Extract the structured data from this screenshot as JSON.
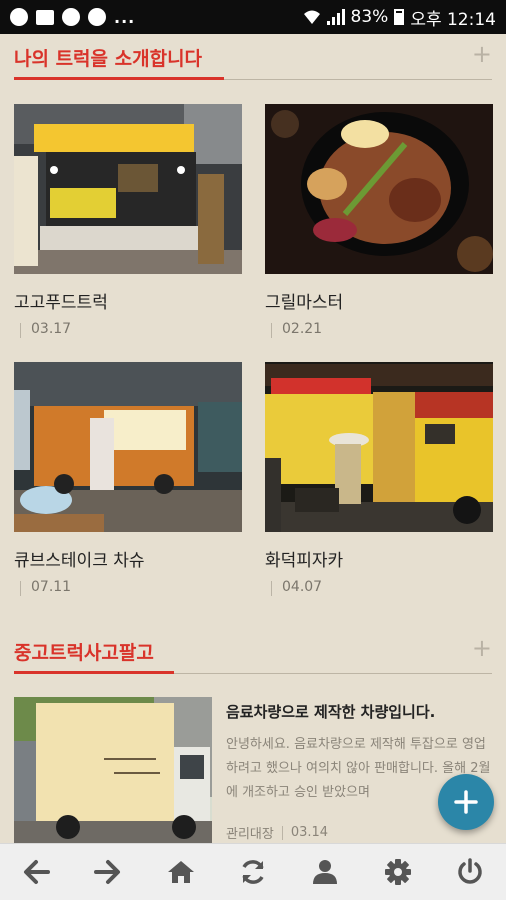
{
  "status_bar": {
    "battery": "83%",
    "time": "오후 12:14",
    "more": "..."
  },
  "sections": {
    "trucks": {
      "title": "나의 트럭을 소개합니다",
      "items": [
        {
          "title": "고고푸드트럭",
          "date": "03.17"
        },
        {
          "title": "그릴마스터",
          "date": "02.21"
        },
        {
          "title": "큐브스테이크 차슈",
          "date": "07.11"
        },
        {
          "title": "화덕피자카",
          "date": "04.07"
        }
      ]
    },
    "used": {
      "title": "중고트럭사고팔고",
      "post": {
        "title": "음료차량으로 제작한 차량입니다.",
        "body": "안녕하세요. 음료차량으로 제작해 투잡으로 영업 하려고 했으나 여의치 않아 판매합니다. 올해 2월에 개조하고 승인 받았으며",
        "author": "관리대장",
        "date": "03.14"
      }
    }
  },
  "bottom_nav": [
    "arrow-left-icon",
    "arrow-right-icon",
    "home-icon",
    "refresh-icon",
    "user-icon",
    "gear-icon",
    "power-icon"
  ],
  "colors": {
    "accent": "#d9332a",
    "fab": "#2b86a8",
    "background": "#e6dfd0"
  }
}
